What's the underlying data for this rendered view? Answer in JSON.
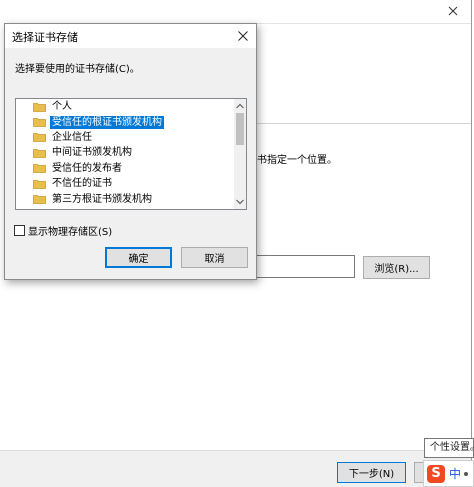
{
  "background": {
    "location_text": "书指定一个位置。",
    "browse_label": "浏览(R)...",
    "next_label": "下一步(N)",
    "tooltip": "个性设置。",
    "ime_lang": "中"
  },
  "dialog": {
    "title": "选择证书存储",
    "prompt": "选择要使用的证书存储(C)。",
    "stores": [
      {
        "label": "个人",
        "selected": false
      },
      {
        "label": "受信任的根证书颁发机构",
        "selected": true
      },
      {
        "label": "企业信任",
        "selected": false
      },
      {
        "label": "中间证书颁发机构",
        "selected": false
      },
      {
        "label": "受信任的发布者",
        "selected": false
      },
      {
        "label": "不信任的证书",
        "selected": false
      },
      {
        "label": "第三方根证书颁发机构",
        "selected": false
      }
    ],
    "show_physical_label": "显示物理存储区(S)",
    "show_physical_checked": false,
    "ok_label": "确定",
    "cancel_label": "取消"
  },
  "colors": {
    "selection": "#0078d7",
    "folder": "#e8bf4f",
    "dialog_bg": "#f0f0f0"
  },
  "icons": [
    "folder-icon",
    "close-icon",
    "scroll-up-icon",
    "scroll-down-icon",
    "sogou-ime-icon"
  ]
}
